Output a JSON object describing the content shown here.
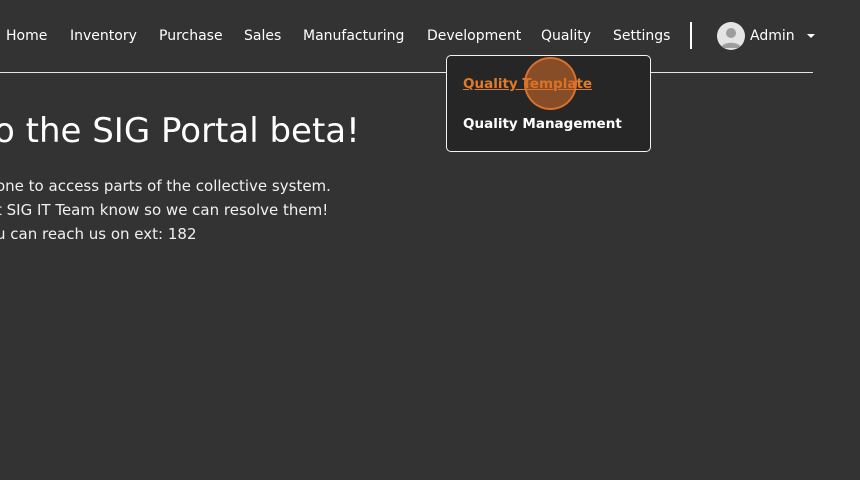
{
  "nav": {
    "items": [
      {
        "label": "Home"
      },
      {
        "label": "Inventory"
      },
      {
        "label": "Purchase"
      },
      {
        "label": "Sales"
      },
      {
        "label": "Manufacturing"
      },
      {
        "label": "Development"
      },
      {
        "label": "Quality"
      },
      {
        "label": "Settings"
      }
    ],
    "user": {
      "name": "Admin",
      "avatar_icon": "user-avatar-icon",
      "caret_icon": "caret-down-icon"
    }
  },
  "main": {
    "headline": "o the SIG Portal beta!",
    "lines": [
      "one to access parts of the collective system.",
      "t SIG IT Team know so we can resolve them!",
      "u can reach us on ext: 182"
    ]
  },
  "dropdown": {
    "items": [
      {
        "label": "Quality Template",
        "active": true
      },
      {
        "label": "Quality Management",
        "active": false
      }
    ],
    "active_color": "#e07b29"
  },
  "colors": {
    "background": "#333333",
    "dropdown_background": "#262626",
    "accent": "#e07b29"
  }
}
